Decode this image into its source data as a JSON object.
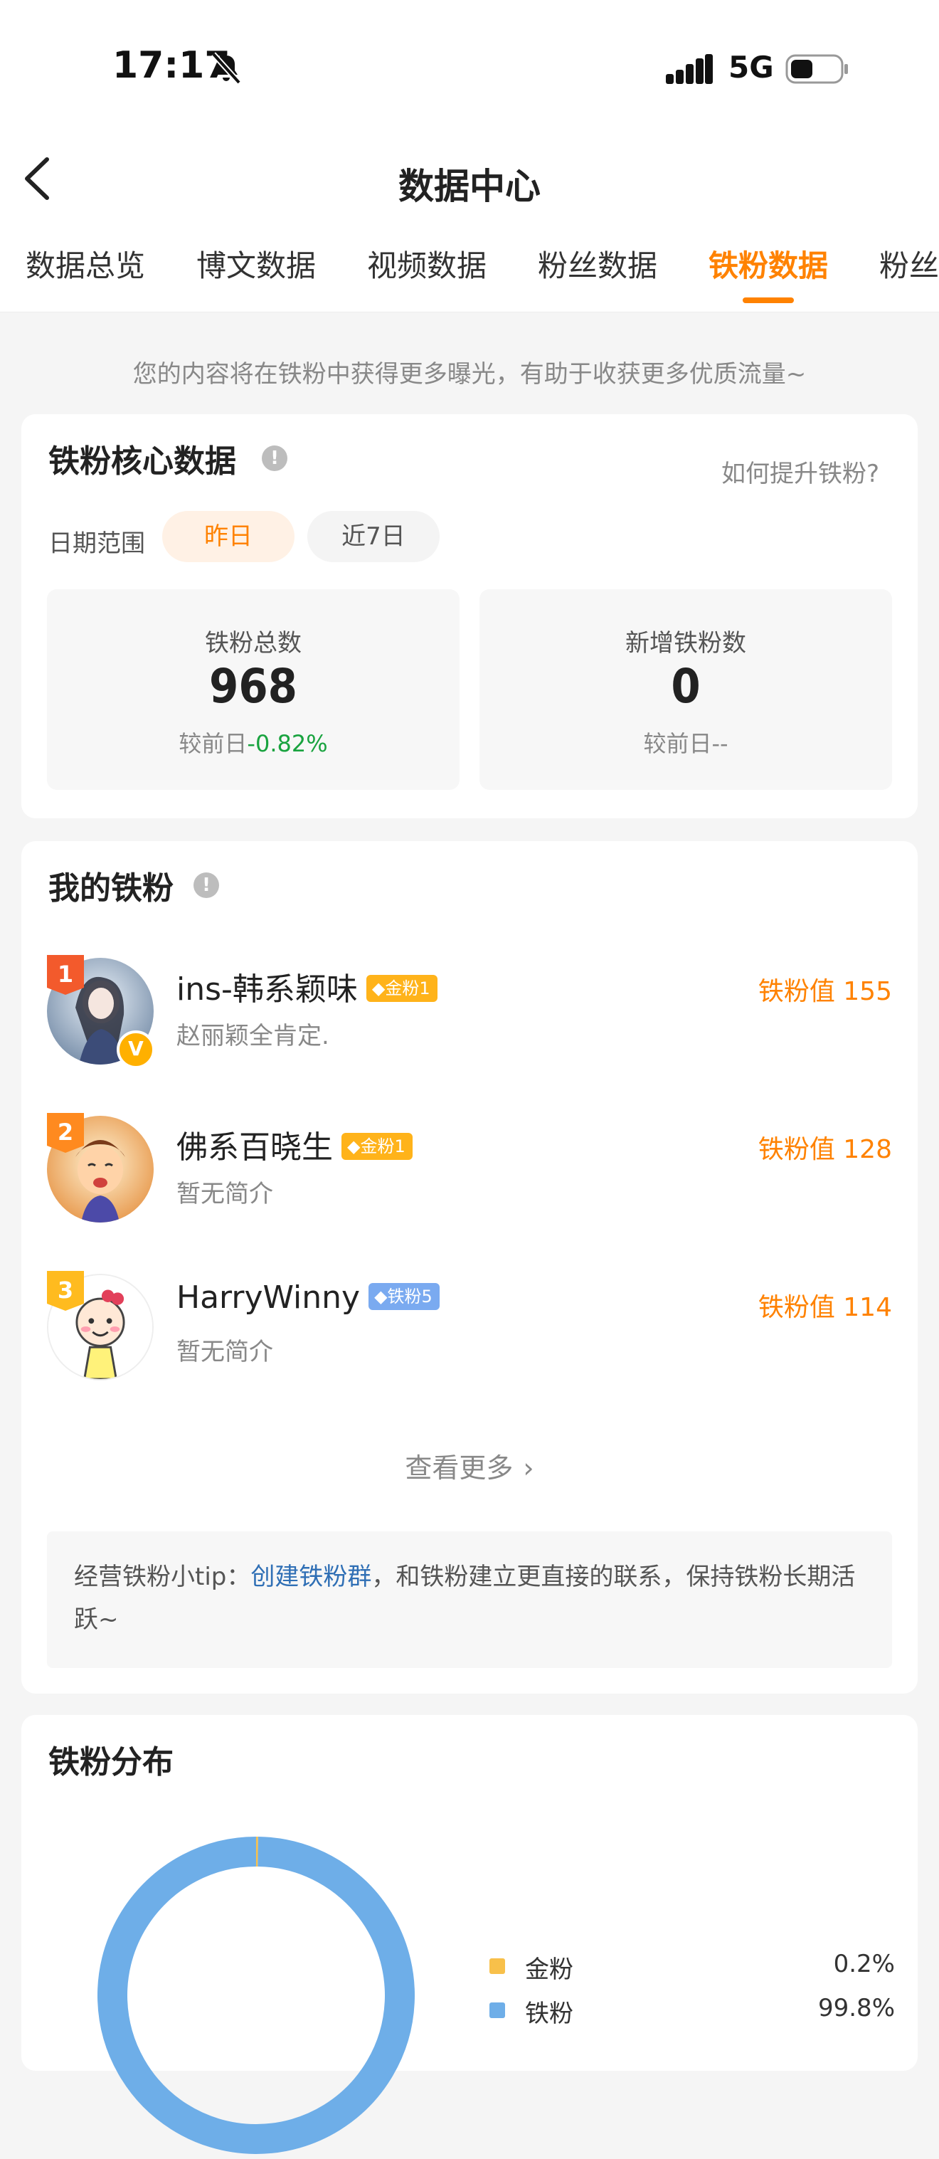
{
  "status_bar": {
    "time": "17:17",
    "network": "5G"
  },
  "nav": {
    "title": "数据中心"
  },
  "tabs": [
    {
      "label": "数据总览"
    },
    {
      "label": "博文数据"
    },
    {
      "label": "视频数据"
    },
    {
      "label": "粉丝数据"
    },
    {
      "label": "铁粉数据"
    },
    {
      "label": "粉丝"
    }
  ],
  "active_tab": "铁粉数据",
  "notice": "您的内容将在铁粉中获得更多曝光，有助于收获更多优质流量~",
  "core": {
    "title": "铁粉核心数据",
    "howto": "如何提升铁粉?",
    "range_label": "日期范围",
    "ranges": [
      "昨日",
      "近7日"
    ],
    "selected_range": "昨日",
    "stats": [
      {
        "label": "铁粉总数",
        "value": "968",
        "compare_prefix": "较前日",
        "compare_value": "-0.82%"
      },
      {
        "label": "新增铁粉数",
        "value": "0",
        "compare_prefix": "较前日",
        "compare_value": "--"
      }
    ]
  },
  "my_fans": {
    "title": "我的铁粉",
    "fans": [
      {
        "rank": "1",
        "name": "ins-韩系颖味",
        "level": "金粉1",
        "bio": "赵丽颖全肯定.",
        "value_label": "铁粉值 155"
      },
      {
        "rank": "2",
        "name": "佛系百晓生",
        "level": "金粉1",
        "bio": "暂无简介",
        "value_label": "铁粉值 128"
      },
      {
        "rank": "3",
        "name": "HarryWinny",
        "level": "铁粉5",
        "bio": "暂无简介",
        "value_label": "铁粉值 114"
      }
    ],
    "more_label": "查看更多",
    "tip": {
      "prefix": "经营铁粉小tip：",
      "link": "创建铁粉群",
      "suffix": "，和铁粉建立更直接的联系，保持铁粉长期活跃~"
    }
  },
  "distribution": {
    "title": "铁粉分布",
    "legend": [
      {
        "name": "金粉",
        "value": "0.2%",
        "color": "#f8c04a"
      },
      {
        "name": "铁粉",
        "value": "99.8%",
        "color": "#6eaee8"
      }
    ]
  },
  "chart_data": {
    "type": "pie",
    "categories": [
      "金粉",
      "铁粉"
    ],
    "values": [
      0.2,
      99.8
    ],
    "colors": [
      "#f8c04a",
      "#6eaee8"
    ]
  },
  "colors": {
    "accent": "#ff8200",
    "positive": "#19a33f",
    "link": "#2f6fb5",
    "bar_blue": "#6eaee8",
    "gold": "#f8c04a"
  }
}
